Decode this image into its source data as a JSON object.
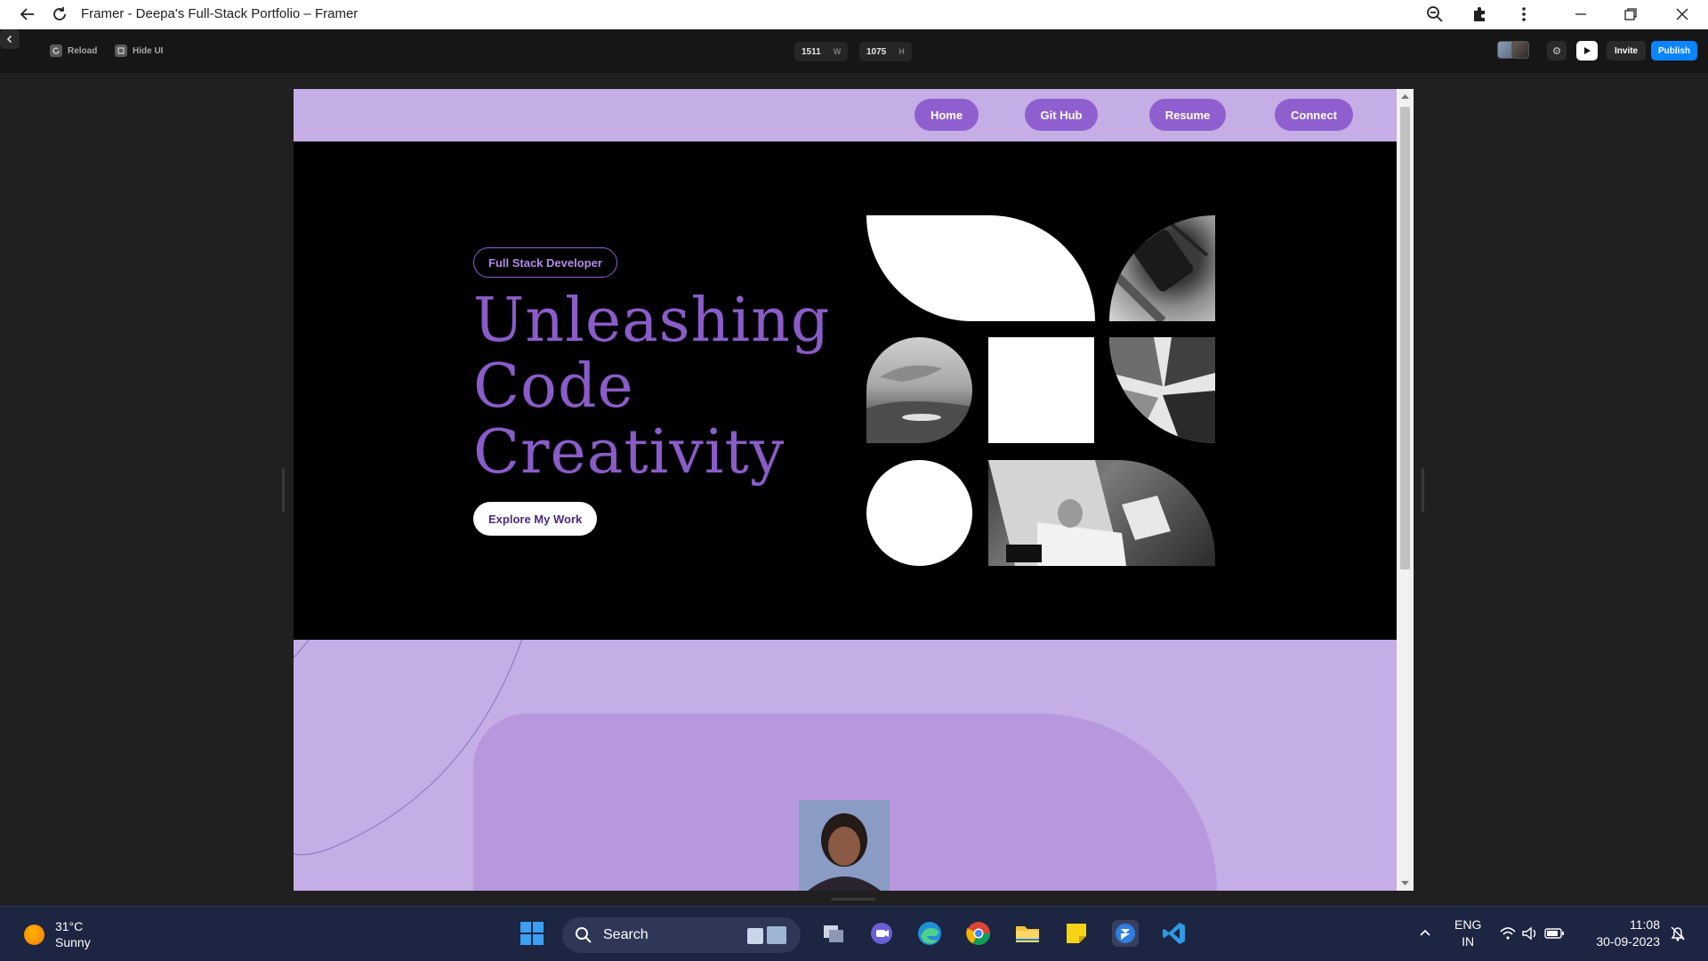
{
  "window": {
    "title": "Framer - Deepa's Full-Stack Portfolio – Framer"
  },
  "toolbar": {
    "reload_label": "Reload",
    "hide_ui_label": "Hide UI",
    "width_value": "1511",
    "width_unit": "W",
    "height_value": "1075",
    "height_unit": "H",
    "invite_label": "Invite",
    "publish_label": "Publish",
    "accent_color": "#0a84ff"
  },
  "site": {
    "nav": {
      "items": [
        {
          "label": "Home"
        },
        {
          "label": "Git Hub"
        },
        {
          "label": "Resume"
        },
        {
          "label": "Connect"
        }
      ]
    },
    "hero": {
      "badge": "Full Stack Developer",
      "headline_lines": [
        "Unleashing",
        "Code",
        "Creativity"
      ],
      "cta_label": "Explore My Work"
    },
    "colors": {
      "lavender": "#c5ade5",
      "purple": "#8f5fcf",
      "headline": "#8a5cc8",
      "hero_bg": "#000000"
    }
  },
  "taskbar": {
    "weather_temp": "31°C",
    "weather_condition": "Sunny",
    "search_placeholder": "Search",
    "language_primary": "ENG",
    "language_secondary": "IN",
    "time": "11:08",
    "date": "30-09-2023"
  }
}
